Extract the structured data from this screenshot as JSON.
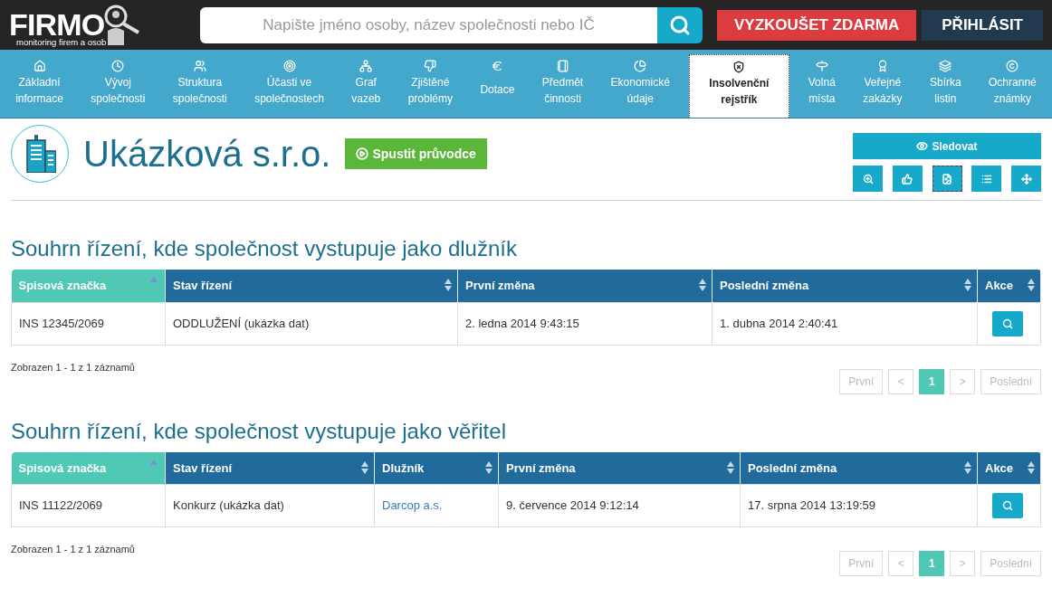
{
  "header": {
    "logo": "FIRMO",
    "tagline": "monitoring firem a osob",
    "search": {
      "placeholder": "Napište jméno osoby, název společnosti nebo IČ"
    },
    "buttons": [
      {
        "label": "VYZKOUŠET ZDARMA",
        "kind": "primary"
      },
      {
        "label": "PŘIHLÁSIT",
        "kind": "secondary"
      }
    ]
  },
  "nav": [
    {
      "lines": [
        "Základní",
        "informace"
      ],
      "selected": false
    },
    {
      "lines": [
        "Vývoj",
        "společnosti"
      ],
      "selected": false
    },
    {
      "lines": [
        "Struktura",
        "společnosti"
      ],
      "selected": false
    },
    {
      "lines": [
        "Účasti ve",
        "společnostech"
      ],
      "selected": false
    },
    {
      "lines": [
        "Graf",
        "vazeb"
      ],
      "selected": false
    },
    {
      "lines": [
        "Zjištěné",
        "problémy"
      ],
      "selected": false
    },
    {
      "lines": [
        "Dotace"
      ],
      "selected": false
    },
    {
      "lines": [
        "Předmět",
        "činnosti"
      ],
      "selected": false
    },
    {
      "lines": [
        "Ekonomické",
        "údaje"
      ],
      "selected": false
    },
    {
      "lines": [
        "Insolvenční",
        "rejstřík"
      ],
      "selected": true
    },
    {
      "lines": [
        "Volná",
        "místa"
      ],
      "selected": false
    },
    {
      "lines": [
        "Veřejné",
        "zakázky"
      ],
      "selected": false
    },
    {
      "lines": [
        "Sbírka",
        "listin"
      ],
      "selected": false
    },
    {
      "lines": [
        "Ochranné",
        "známky"
      ],
      "selected": false
    }
  ],
  "company": {
    "name": "Ukázková s.r.o.",
    "guide_button": "Spustit průvodce",
    "follow_button": "Sledovat",
    "tools": [
      {
        "focused": false
      },
      {
        "focused": false
      },
      {
        "focused": true
      },
      {
        "focused": false
      },
      {
        "focused": false
      }
    ]
  },
  "sections": [
    {
      "title": "Souhrn řízení, kde společnost vystupuje jako dlužník",
      "columns": [
        {
          "label": "Spisová značka",
          "sorted": true
        },
        {
          "label": "Stav řízení",
          "sorted": false
        },
        {
          "label": "První změna",
          "sorted": false
        },
        {
          "label": "Poslední změna",
          "sorted": false
        },
        {
          "label": "Akce",
          "sorted": false
        }
      ],
      "rows": [
        [
          {
            "kind": "text",
            "text": "INS 12345/2069"
          },
          {
            "kind": "text",
            "text": "ODDLUŽENÍ (ukázka dat)"
          },
          {
            "kind": "text",
            "text": "2. ledna 2014 9:43:15"
          },
          {
            "kind": "text",
            "text": "1. dubna 2014 2:40:41"
          },
          {
            "kind": "action"
          }
        ]
      ],
      "info": "Zobrazen 1 - 1 z 1 záznamů",
      "pagination": [
        {
          "label": "První",
          "kind": "nav",
          "disabled": true,
          "selected": false
        },
        {
          "label": "<",
          "kind": "nav",
          "disabled": true,
          "selected": false
        },
        {
          "label": "1",
          "kind": "page",
          "disabled": false,
          "selected": true
        },
        {
          "label": ">",
          "kind": "nav",
          "disabled": true,
          "selected": false
        },
        {
          "label": "Poslední",
          "kind": "nav",
          "disabled": true,
          "selected": false
        }
      ]
    },
    {
      "title": "Souhrn řízení, kde společnost vystupuje jako věřitel",
      "columns": [
        {
          "label": "Spisová značka",
          "sorted": true
        },
        {
          "label": "Stav řízení",
          "sorted": false
        },
        {
          "label": "Dlužník",
          "sorted": false
        },
        {
          "label": "První změna",
          "sorted": false
        },
        {
          "label": "Poslední změna",
          "sorted": false
        },
        {
          "label": "Akce",
          "sorted": false
        }
      ],
      "rows": [
        [
          {
            "kind": "text",
            "text": "INS 11122/2069"
          },
          {
            "kind": "text",
            "text": "Konkurz (ukázka dat)"
          },
          {
            "kind": "link",
            "text": "Darcop a.s."
          },
          {
            "kind": "text",
            "text": "9. července 2014 9:12:14"
          },
          {
            "kind": "text",
            "text": "17. srpna 2014 13:19:59"
          },
          {
            "kind": "action"
          }
        ]
      ],
      "info": "Zobrazen 1 - 1 z 1 záznamů",
      "pagination": [
        {
          "label": "První",
          "kind": "nav",
          "disabled": true,
          "selected": false
        },
        {
          "label": "<",
          "kind": "nav",
          "disabled": true,
          "selected": false
        },
        {
          "label": "1",
          "kind": "page",
          "disabled": false,
          "selected": true
        },
        {
          "label": ">",
          "kind": "nav",
          "disabled": true,
          "selected": false
        },
        {
          "label": "Poslední",
          "kind": "nav",
          "disabled": true,
          "selected": false
        }
      ]
    }
  ]
}
